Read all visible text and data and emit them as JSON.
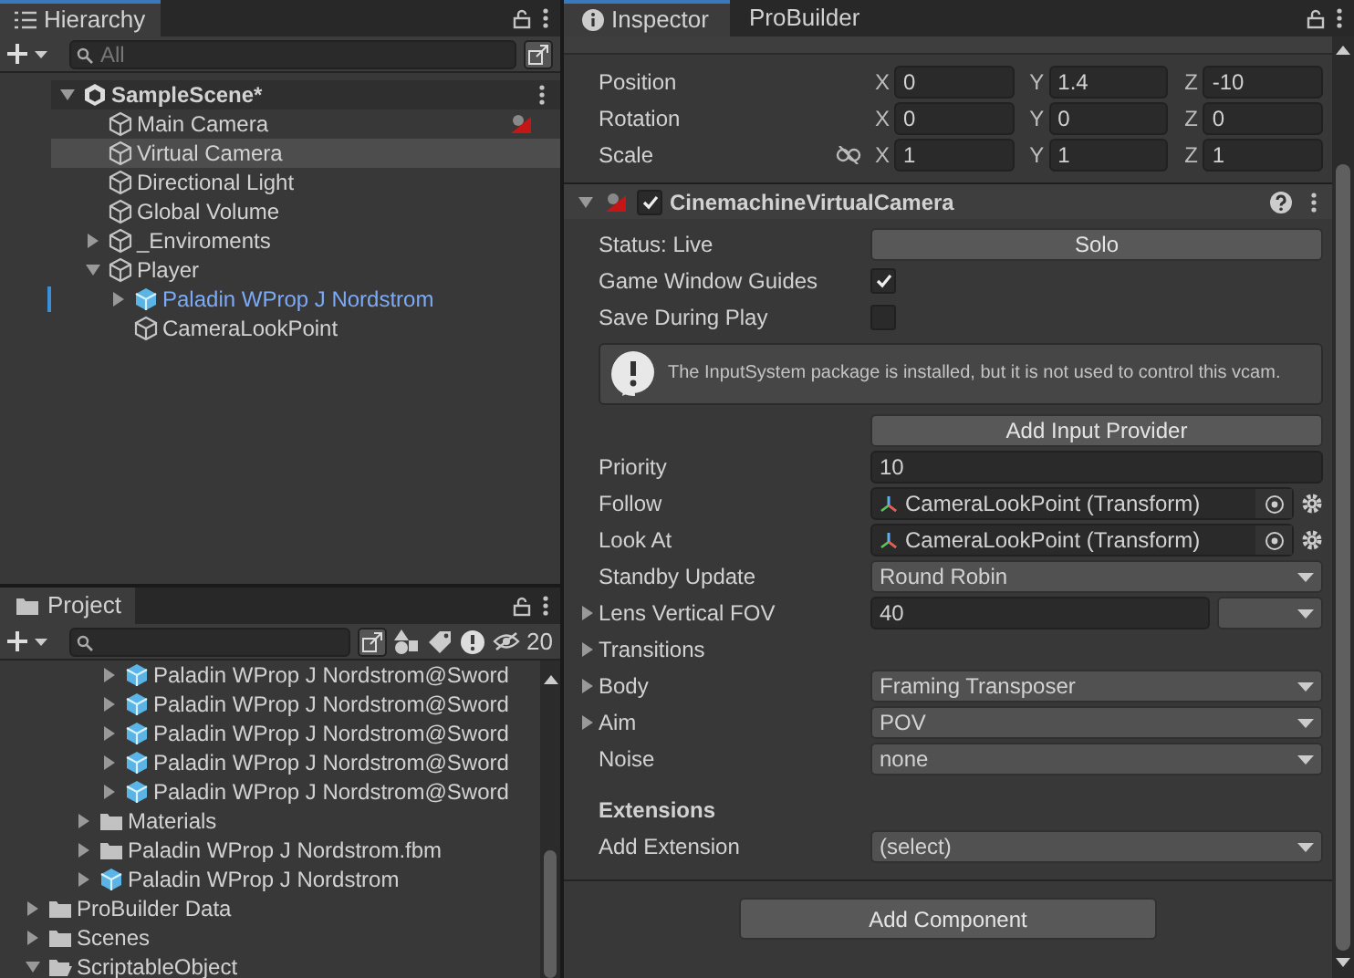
{
  "hierarchy": {
    "title": "Hierarchy",
    "search_placeholder": "All",
    "scene": {
      "name": "SampleScene*",
      "expanded": true,
      "children": [
        {
          "name": "Main Camera",
          "kind": "object",
          "selected": false
        },
        {
          "name": "Virtual Camera",
          "kind": "object",
          "selected": true
        },
        {
          "name": "Directional Light",
          "kind": "object",
          "selected": false
        },
        {
          "name": "Global Volume",
          "kind": "object",
          "selected": false
        },
        {
          "name": "_Enviroments",
          "kind": "object",
          "selected": false,
          "expanded": false
        },
        {
          "name": "Player",
          "kind": "object",
          "selected": false,
          "expanded": true,
          "children": [
            {
              "name": "Paladin WProp J Nordstrom",
              "kind": "prefab",
              "selected": false,
              "expanded": false
            },
            {
              "name": "CameraLookPoint",
              "kind": "object",
              "selected": false
            }
          ]
        }
      ]
    }
  },
  "project": {
    "title": "Project",
    "hidden_count": "20",
    "tree": [
      {
        "children": [
          {
            "children": [
              {
                "children": [
                  {
                    "name": "Paladin WProp J Nordstrom@Sword",
                    "kind": "prefab",
                    "expanded": false
                  },
                  {
                    "name": "Paladin WProp J Nordstrom@Sword",
                    "kind": "prefab",
                    "expanded": false
                  },
                  {
                    "name": "Paladin WProp J Nordstrom@Sword",
                    "kind": "prefab",
                    "expanded": false
                  },
                  {
                    "name": "Paladin WProp J Nordstrom@Sword",
                    "kind": "prefab",
                    "expanded": false
                  },
                  {
                    "name": "Paladin WProp J Nordstrom@Sword",
                    "kind": "prefab",
                    "expanded": false
                  }
                ]
              },
              {
                "name": "Materials",
                "kind": "folder",
                "expanded": false
              },
              {
                "name": "Paladin WProp J Nordstrom.fbm",
                "kind": "folder",
                "expanded": false
              },
              {
                "name": "Paladin WProp J Nordstrom",
                "kind": "prefab",
                "expanded": false
              }
            ]
          }
        ]
      },
      {
        "name": "ProBuilder Data",
        "kind": "folder",
        "expanded": false
      },
      {
        "name": "Scenes",
        "kind": "folder",
        "expanded": false
      },
      {
        "name": "ScriptableObject",
        "kind": "folder",
        "expanded": true
      }
    ]
  },
  "inspector": {
    "tabs": [
      {
        "label": "Inspector",
        "selected": true
      },
      {
        "label": "ProBuilder",
        "selected": false
      }
    ],
    "transform": [
      {
        "label": "Position",
        "fields": [
          {
            "axis": "X",
            "value": "0"
          },
          {
            "axis": "Y",
            "value": "1.4"
          },
          {
            "axis": "Z",
            "value": "-10"
          }
        ]
      },
      {
        "label": "Rotation",
        "fields": [
          {
            "axis": "X",
            "value": "0"
          },
          {
            "axis": "Y",
            "value": "0"
          },
          {
            "axis": "Z",
            "value": "0"
          }
        ]
      },
      {
        "label": "Scale",
        "constrained": false,
        "fields": [
          {
            "axis": "X",
            "value": "1"
          },
          {
            "axis": "Y",
            "value": "1"
          },
          {
            "axis": "Z",
            "value": "1"
          }
        ]
      }
    ],
    "component": {
      "name": "CinemachineVirtualCamera",
      "enabled": true,
      "expanded": true,
      "properties": [
        {
          "kind": "button",
          "label": "Status: Live",
          "button": "Solo"
        },
        {
          "kind": "checkbox",
          "label": "Game Window Guides",
          "checked": true
        },
        {
          "kind": "checkbox",
          "label": "Save During Play",
          "checked": false
        },
        {
          "kind": "helpbox",
          "text": "The InputSystem package is installed, but it is not used to control this vcam."
        },
        {
          "kind": "button",
          "button": "Add Input Provider"
        },
        {
          "kind": "field",
          "label": "Priority",
          "value": "10"
        },
        {
          "kind": "object",
          "label": "Follow",
          "value": "CameraLookPoint (Transform)"
        },
        {
          "kind": "object",
          "label": "Look At",
          "value": "CameraLookPoint (Transform)"
        },
        {
          "kind": "dropdown",
          "label": "Standby Update",
          "value": "Round Robin"
        },
        {
          "kind": "field-dropdown",
          "label": "Lens Vertical FOV",
          "value": "40",
          "expanded": false
        },
        {
          "kind": "foldout",
          "label": "Transitions",
          "expanded": false
        },
        {
          "kind": "dropdown",
          "label": "Body",
          "value": "Framing Transposer",
          "expanded": false
        },
        {
          "kind": "dropdown",
          "label": "Aim",
          "value": "POV",
          "expanded": false
        },
        {
          "kind": "dropdown",
          "label": "Noise",
          "value": "none"
        },
        {
          "kind": "heading",
          "label": "Extensions"
        },
        {
          "kind": "dropdown",
          "label": "Add Extension",
          "value": "(select)"
        }
      ]
    },
    "add_component": "Add Component"
  }
}
